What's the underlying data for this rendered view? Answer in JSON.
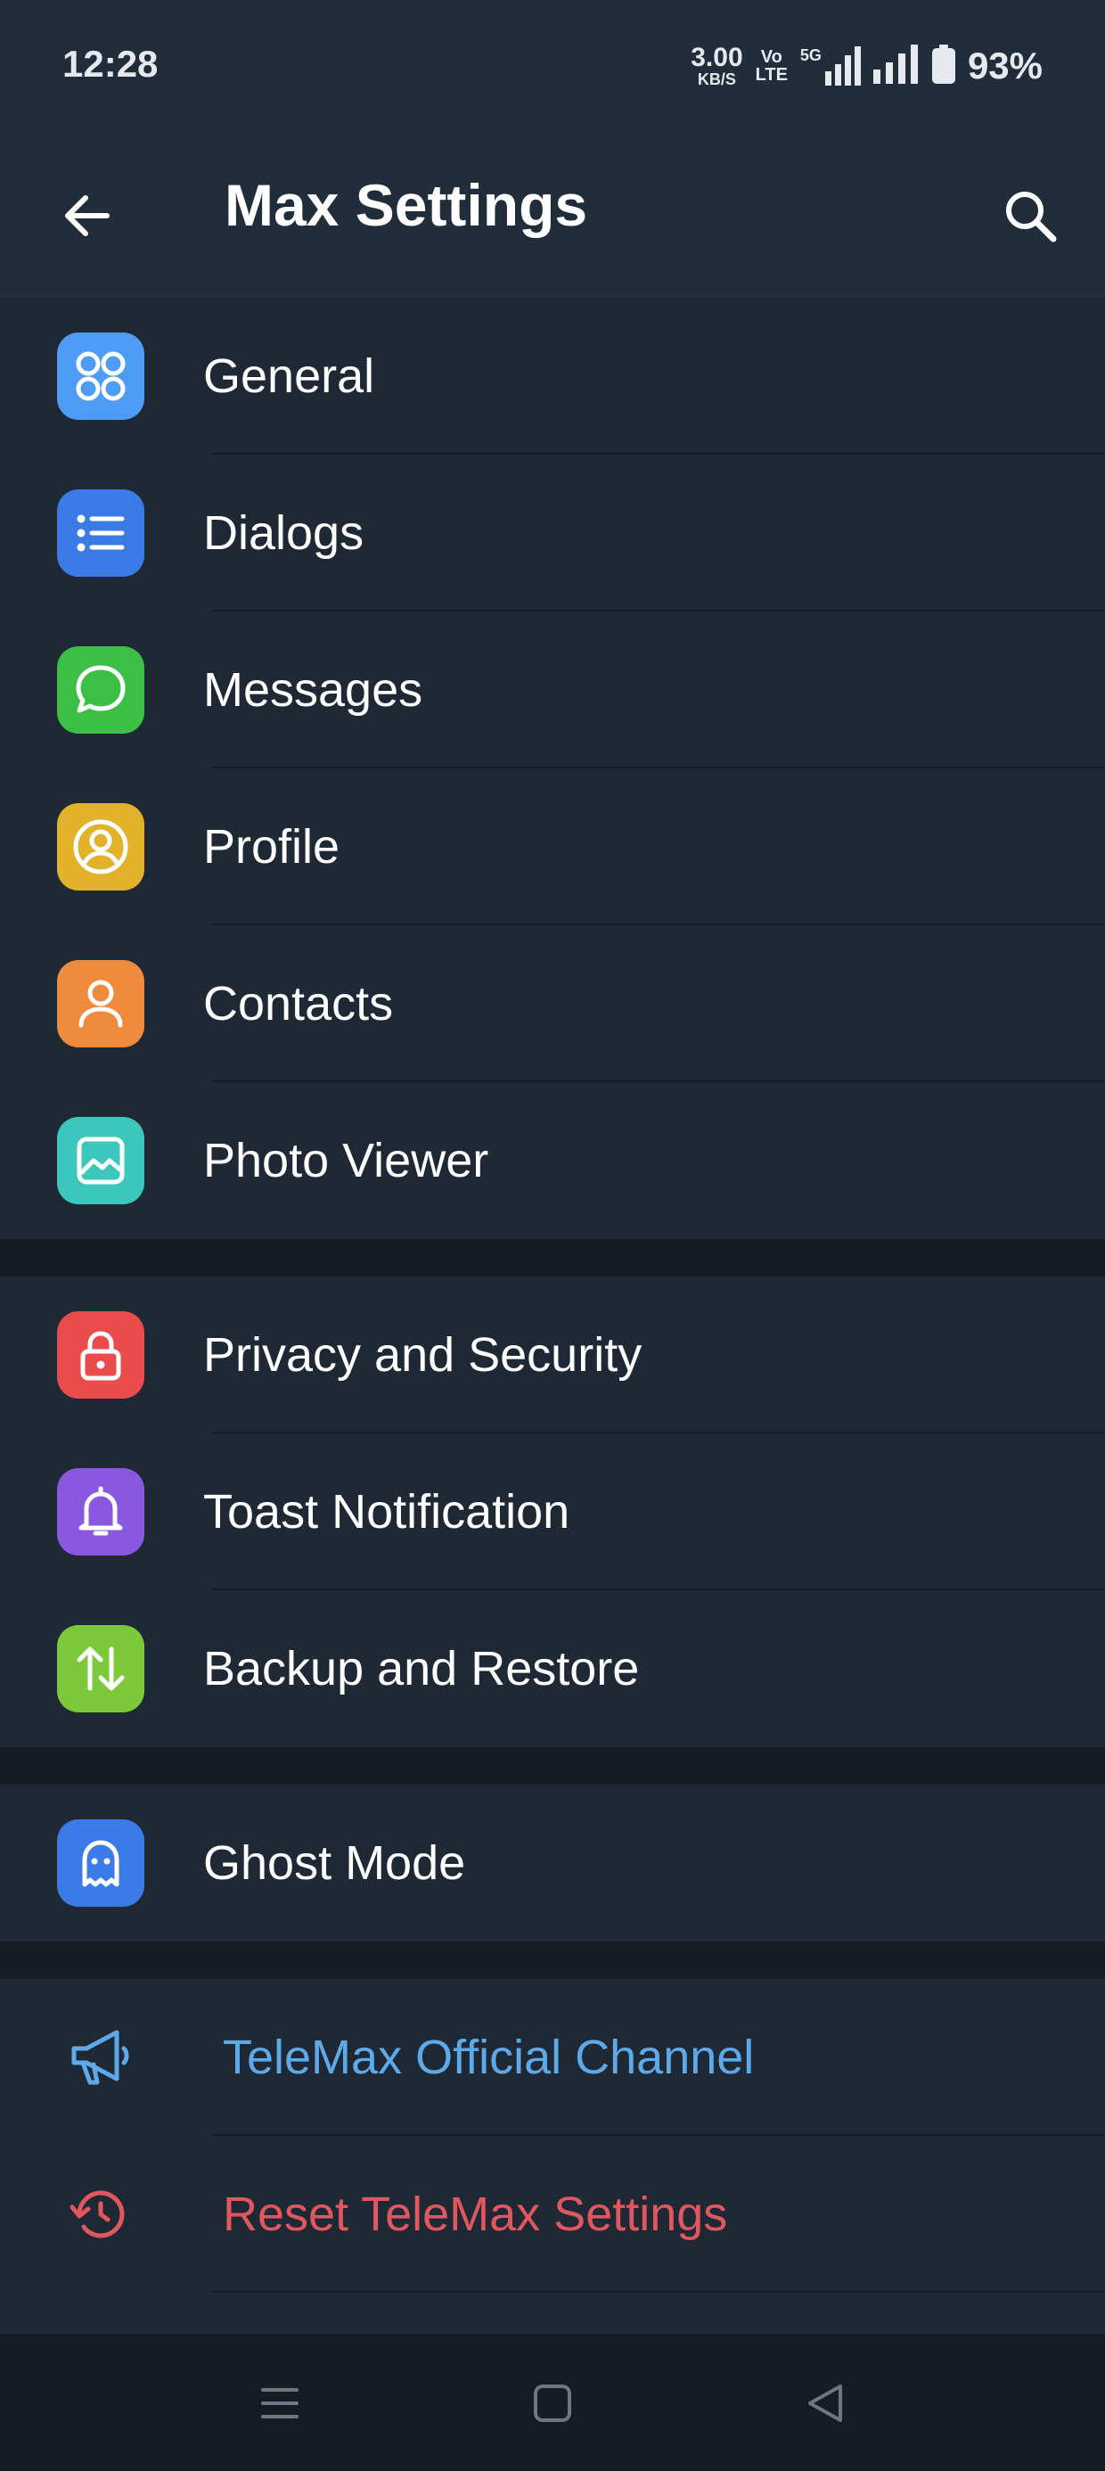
{
  "status_bar": {
    "time": "12:28",
    "net_speed_value": "3.00",
    "net_speed_unit": "KB/S",
    "volte_top": "Vo",
    "volte_bottom": "LTE",
    "network": "5G",
    "battery": "93%"
  },
  "app_bar": {
    "title": "Max Settings",
    "back_icon": "arrow-left-icon",
    "search_icon": "search-icon"
  },
  "sections": [
    {
      "items": [
        {
          "label": "General",
          "icon": "grid-circles-icon",
          "color": "#4e9cf5"
        },
        {
          "label": "Dialogs",
          "icon": "list-icon",
          "color": "#3a7be8"
        },
        {
          "label": "Messages",
          "icon": "chat-bubble-icon",
          "color": "#3cbf45"
        },
        {
          "label": "Profile",
          "icon": "user-circle-icon",
          "color": "#e2b22a"
        },
        {
          "label": "Contacts",
          "icon": "user-icon",
          "color": "#f08a3c"
        },
        {
          "label": "Photo Viewer",
          "icon": "image-icon",
          "color": "#3cc7bc"
        }
      ]
    },
    {
      "items": [
        {
          "label": "Privacy and Security",
          "icon": "lock-icon",
          "color": "#ea4c4c"
        },
        {
          "label": "Toast Notification",
          "icon": "bell-icon",
          "color": "#8a58e0"
        },
        {
          "label": "Backup and Restore",
          "icon": "arrows-up-down-icon",
          "color": "#7cc93a"
        }
      ]
    },
    {
      "items": [
        {
          "label": "Ghost Mode",
          "icon": "ghost-icon",
          "color": "#3a7be8"
        }
      ]
    },
    {
      "items": [
        {
          "label": "TeleMax Official Channel",
          "icon": "megaphone-icon",
          "color": "#5eaae8"
        },
        {
          "label": "Reset TeleMax Settings",
          "icon": "reset-icon",
          "color": "#e0575f"
        }
      ]
    }
  ],
  "nav_bar": {
    "menu_icon": "menu-icon",
    "home_icon": "home-square-icon",
    "back_icon": "back-triangle-icon"
  }
}
